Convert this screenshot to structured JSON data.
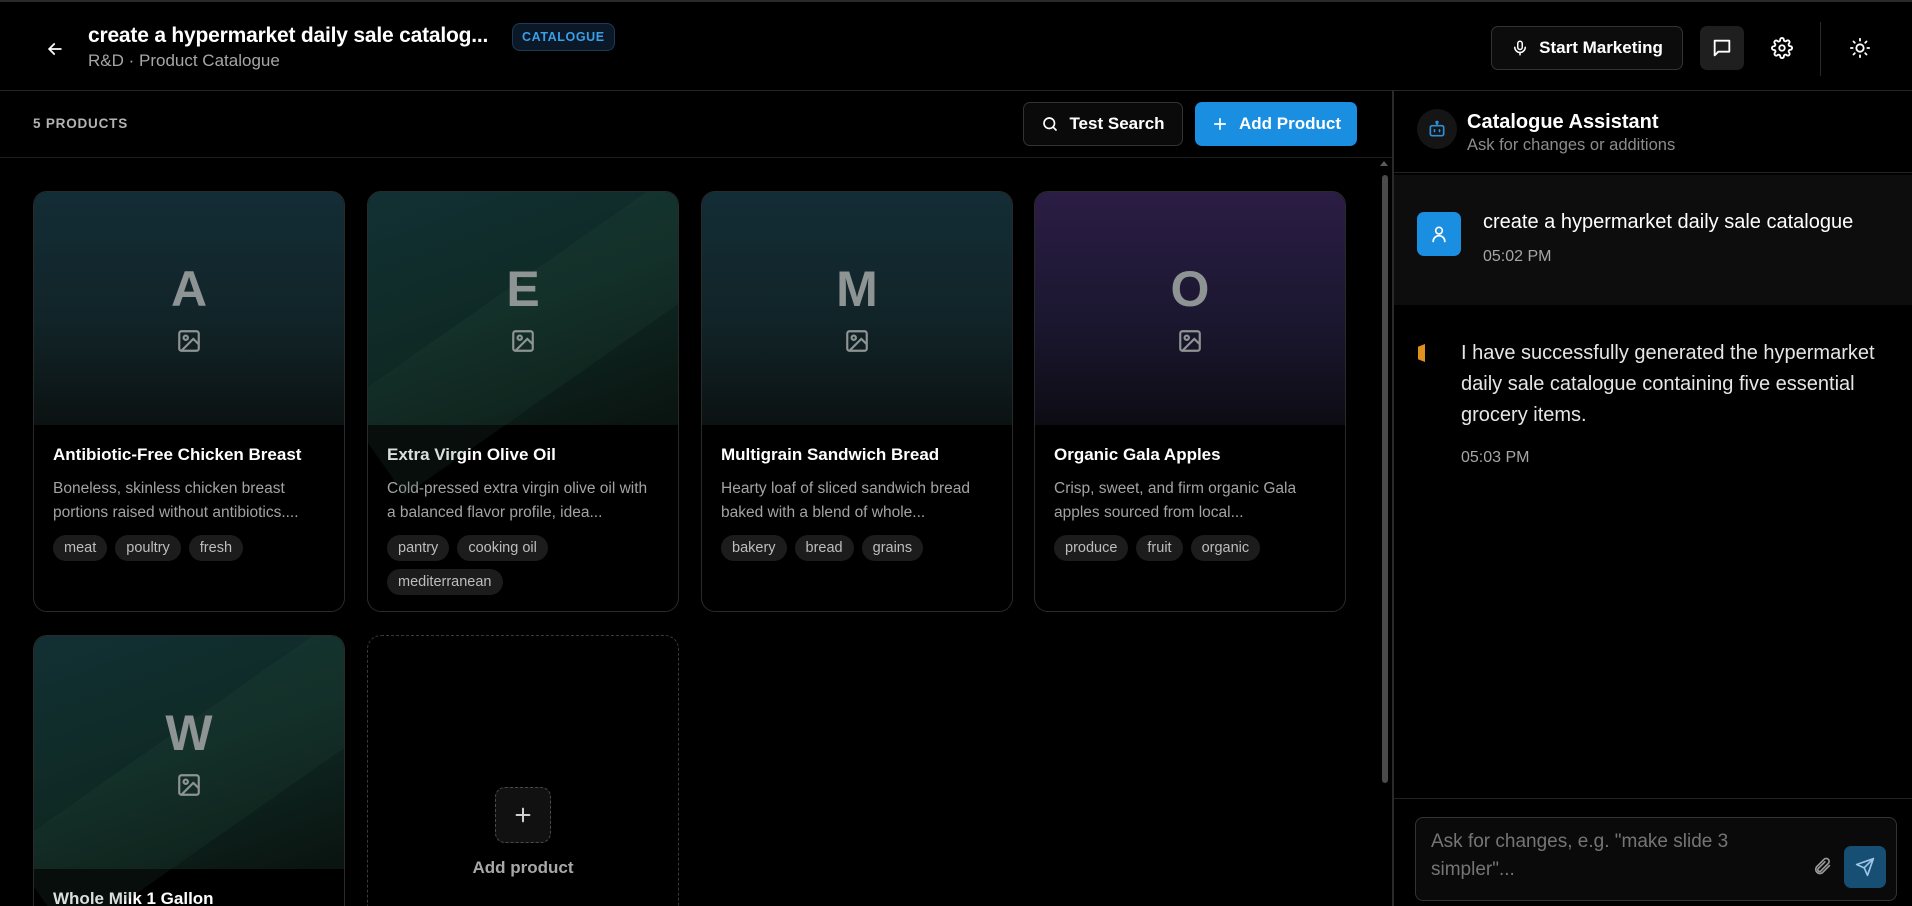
{
  "header": {
    "title": "create a hypermarket daily sale catalog...",
    "badge": "CATALOGUE",
    "subtitle": "R&D · Product Catalogue",
    "start_marketing_label": "Start Marketing",
    "icons": [
      "back-arrow-icon",
      "microphone-icon",
      "chat-icon",
      "gear-icon",
      "sun-icon"
    ]
  },
  "toolbar": {
    "count": "5 PRODUCTS",
    "test_search_label": "Test Search",
    "add_product_label": "Add Product"
  },
  "products": [
    {
      "letter": "A",
      "title": "Antibiotic-Free Chicken Breast",
      "description": "Boneless, skinless chicken breast portions raised without antibiotics....",
      "tags": [
        "meat",
        "poultry",
        "fresh"
      ]
    },
    {
      "letter": "E",
      "title": "Extra Virgin Olive Oil",
      "description": "Cold-pressed extra virgin olive oil with a balanced flavor profile, idea...",
      "tags": [
        "pantry",
        "cooking oil",
        "mediterranean"
      ]
    },
    {
      "letter": "M",
      "title": "Multigrain Sandwich Bread",
      "description": "Hearty loaf of sliced sandwich bread baked with a blend of whole...",
      "tags": [
        "bakery",
        "bread",
        "grains"
      ]
    },
    {
      "letter": "O",
      "title": "Organic Gala Apples",
      "description": "Crisp, sweet, and firm organic Gala apples sourced from local...",
      "tags": [
        "produce",
        "fruit",
        "organic"
      ]
    },
    {
      "letter": "W",
      "title": "Whole Milk 1 Gallon",
      "description": "",
      "tags": []
    }
  ],
  "add_card": {
    "label": "Add product"
  },
  "assistant": {
    "title": "Catalogue Assistant",
    "subtitle": "Ask for changes or additions",
    "messages": [
      {
        "role": "user",
        "text": "create a hypermarket daily sale catalogue",
        "time": "05:02 PM"
      },
      {
        "role": "assistant",
        "text": "I have successfully generated the hypermarket daily sale catalogue containing five essential grocery items.",
        "time": "05:03 PM"
      }
    ],
    "input_placeholder": "Ask for changes, e.g. \"make slide 3 simpler\"..."
  },
  "colors": {
    "accent": "#1a8ee0",
    "badge_text": "#3b9ee8",
    "bot_marker": "#e0901c",
    "background": "#000000"
  }
}
